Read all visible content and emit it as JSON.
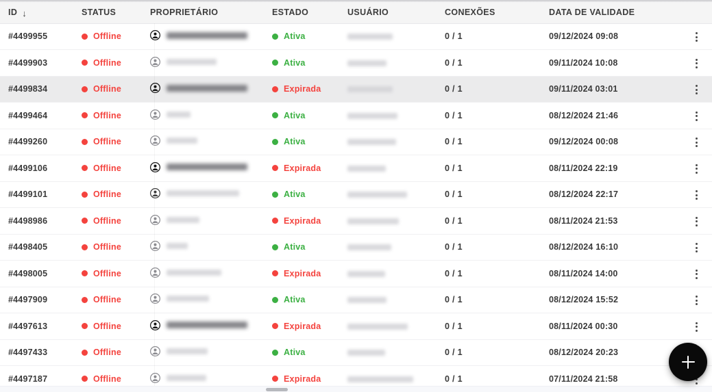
{
  "table": {
    "columns": [
      {
        "key": "id",
        "label": "ID",
        "sort_icon": "arrow-down-icon",
        "sorted": true
      },
      {
        "key": "status",
        "label": "STATUS",
        "sorted": false
      },
      {
        "key": "owner",
        "label": "PROPRIETÁRIO",
        "sorted": false
      },
      {
        "key": "state",
        "label": "ESTADO",
        "sorted": false
      },
      {
        "key": "user",
        "label": "USUÁRIO",
        "sorted": false
      },
      {
        "key": "conn",
        "label": "CONEXÕES",
        "sorted": false
      },
      {
        "key": "date",
        "label": "DATA DE VALIDADE",
        "sorted": false
      },
      {
        "key": "menu",
        "label": "",
        "sorted": false
      }
    ],
    "rows": [
      {
        "id": "#4499955",
        "status": "Offline",
        "status_color": "#f4433e",
        "owner_icon": "person-icon",
        "owner_icon_tone": "dark",
        "owner_redacted_width": 118,
        "owner_redacted_tone": "dark",
        "state": "Ativa",
        "state_color": "#3cb043",
        "user_redacted_width": 66,
        "conn": "0 / 1",
        "date": "09/12/2024 09:08",
        "menu_icon": "kebab-menu-icon",
        "hovered": false
      },
      {
        "id": "#4499903",
        "status": "Offline",
        "status_color": "#f4433e",
        "owner_icon": "person-icon",
        "owner_icon_tone": "light",
        "owner_redacted_width": 73,
        "owner_redacted_tone": "light",
        "state": "Ativa",
        "state_color": "#3cb043",
        "user_redacted_width": 57,
        "conn": "0 / 1",
        "date": "09/11/2024 10:08",
        "menu_icon": "kebab-menu-icon",
        "hovered": false
      },
      {
        "id": "#4499834",
        "status": "Offline",
        "status_color": "#f4433e",
        "owner_icon": "person-icon",
        "owner_icon_tone": "dark",
        "owner_redacted_width": 118,
        "owner_redacted_tone": "dark",
        "state": "Expirada",
        "state_color": "#f4433e",
        "user_redacted_width": 66,
        "conn": "0 / 1",
        "date": "09/11/2024 03:01",
        "menu_icon": "kebab-menu-icon",
        "hovered": true
      },
      {
        "id": "#4499464",
        "status": "Offline",
        "status_color": "#f4433e",
        "owner_icon": "person-icon",
        "owner_icon_tone": "light",
        "owner_redacted_width": 35,
        "owner_redacted_tone": "light",
        "state": "Ativa",
        "state_color": "#3cb043",
        "user_redacted_width": 73,
        "conn": "0 / 1",
        "date": "08/12/2024 21:46",
        "menu_icon": "kebab-menu-icon",
        "hovered": false
      },
      {
        "id": "#4499260",
        "status": "Offline",
        "status_color": "#f4433e",
        "owner_icon": "person-icon",
        "owner_icon_tone": "light",
        "owner_redacted_width": 45,
        "owner_redacted_tone": "light",
        "state": "Ativa",
        "state_color": "#3cb043",
        "user_redacted_width": 71,
        "conn": "0 / 1",
        "date": "09/12/2024 00:08",
        "menu_icon": "kebab-menu-icon",
        "hovered": false
      },
      {
        "id": "#4499106",
        "status": "Offline",
        "status_color": "#f4433e",
        "owner_icon": "person-icon",
        "owner_icon_tone": "dark",
        "owner_redacted_width": 118,
        "owner_redacted_tone": "dark",
        "state": "Expirada",
        "state_color": "#f4433e",
        "user_redacted_width": 56,
        "conn": "0 / 1",
        "date": "08/11/2024 22:19",
        "menu_icon": "kebab-menu-icon",
        "hovered": false
      },
      {
        "id": "#4499101",
        "status": "Offline",
        "status_color": "#f4433e",
        "owner_icon": "person-icon",
        "owner_icon_tone": "mid",
        "owner_redacted_width": 106,
        "owner_redacted_tone": "light",
        "state": "Ativa",
        "state_color": "#3cb043",
        "user_redacted_width": 87,
        "conn": "0 / 1",
        "date": "08/12/2024 22:17",
        "menu_icon": "kebab-menu-icon",
        "hovered": false
      },
      {
        "id": "#4498986",
        "status": "Offline",
        "status_color": "#f4433e",
        "owner_icon": "person-icon",
        "owner_icon_tone": "light",
        "owner_redacted_width": 48,
        "owner_redacted_tone": "light",
        "state": "Expirada",
        "state_color": "#f4433e",
        "user_redacted_width": 75,
        "conn": "0 / 1",
        "date": "08/11/2024 21:53",
        "menu_icon": "kebab-menu-icon",
        "hovered": false
      },
      {
        "id": "#4498405",
        "status": "Offline",
        "status_color": "#f4433e",
        "owner_icon": "person-icon",
        "owner_icon_tone": "light",
        "owner_redacted_width": 31,
        "owner_redacted_tone": "light",
        "state": "Ativa",
        "state_color": "#3cb043",
        "user_redacted_width": 64,
        "conn": "0 / 1",
        "date": "08/12/2024 16:10",
        "menu_icon": "kebab-menu-icon",
        "hovered": false
      },
      {
        "id": "#4498005",
        "status": "Offline",
        "status_color": "#f4433e",
        "owner_icon": "person-icon",
        "owner_icon_tone": "light",
        "owner_redacted_width": 80,
        "owner_redacted_tone": "light",
        "state": "Expirada",
        "state_color": "#f4433e",
        "user_redacted_width": 55,
        "conn": "0 / 1",
        "date": "08/11/2024 14:00",
        "menu_icon": "kebab-menu-icon",
        "hovered": false
      },
      {
        "id": "#4497909",
        "status": "Offline",
        "status_color": "#f4433e",
        "owner_icon": "person-icon",
        "owner_icon_tone": "light",
        "owner_redacted_width": 62,
        "owner_redacted_tone": "light",
        "state": "Ativa",
        "state_color": "#3cb043",
        "user_redacted_width": 57,
        "conn": "0 / 1",
        "date": "08/12/2024 15:52",
        "menu_icon": "kebab-menu-icon",
        "hovered": false
      },
      {
        "id": "#4497613",
        "status": "Offline",
        "status_color": "#f4433e",
        "owner_icon": "person-icon",
        "owner_icon_tone": "dark",
        "owner_redacted_width": 118,
        "owner_redacted_tone": "dark",
        "state": "Expirada",
        "state_color": "#f4433e",
        "user_redacted_width": 88,
        "conn": "0 / 1",
        "date": "08/11/2024 00:30",
        "menu_icon": "kebab-menu-icon",
        "hovered": false
      },
      {
        "id": "#4497433",
        "status": "Offline",
        "status_color": "#f4433e",
        "owner_icon": "person-icon",
        "owner_icon_tone": "light",
        "owner_redacted_width": 60,
        "owner_redacted_tone": "light",
        "state": "Ativa",
        "state_color": "#3cb043",
        "user_redacted_width": 55,
        "conn": "0 / 1",
        "date": "08/12/2024 20:23",
        "menu_icon": "kebab-menu-icon",
        "hovered": false
      },
      {
        "id": "#4497187",
        "status": "Offline",
        "status_color": "#f4433e",
        "owner_icon": "person-icon",
        "owner_icon_tone": "light",
        "owner_redacted_width": 58,
        "owner_redacted_tone": "light",
        "state": "Expirada",
        "state_color": "#f4433e",
        "user_redacted_width": 96,
        "conn": "0 / 1",
        "date": "07/11/2024 21:58",
        "menu_icon": "kebab-menu-icon",
        "hovered": false
      }
    ]
  },
  "fab": {
    "icon": "plus-icon",
    "label": "+",
    "color": "#0a0a0a"
  },
  "scrollbar": {
    "orientation": "horizontal",
    "thumb_color": "#b6b8bd"
  },
  "colors": {
    "status_offline": "#f4433e",
    "state_active": "#3cb043",
    "state_expired": "#f4433e",
    "header_bg": "#f5f5f5",
    "row_hover_bg": "#ebebec"
  }
}
